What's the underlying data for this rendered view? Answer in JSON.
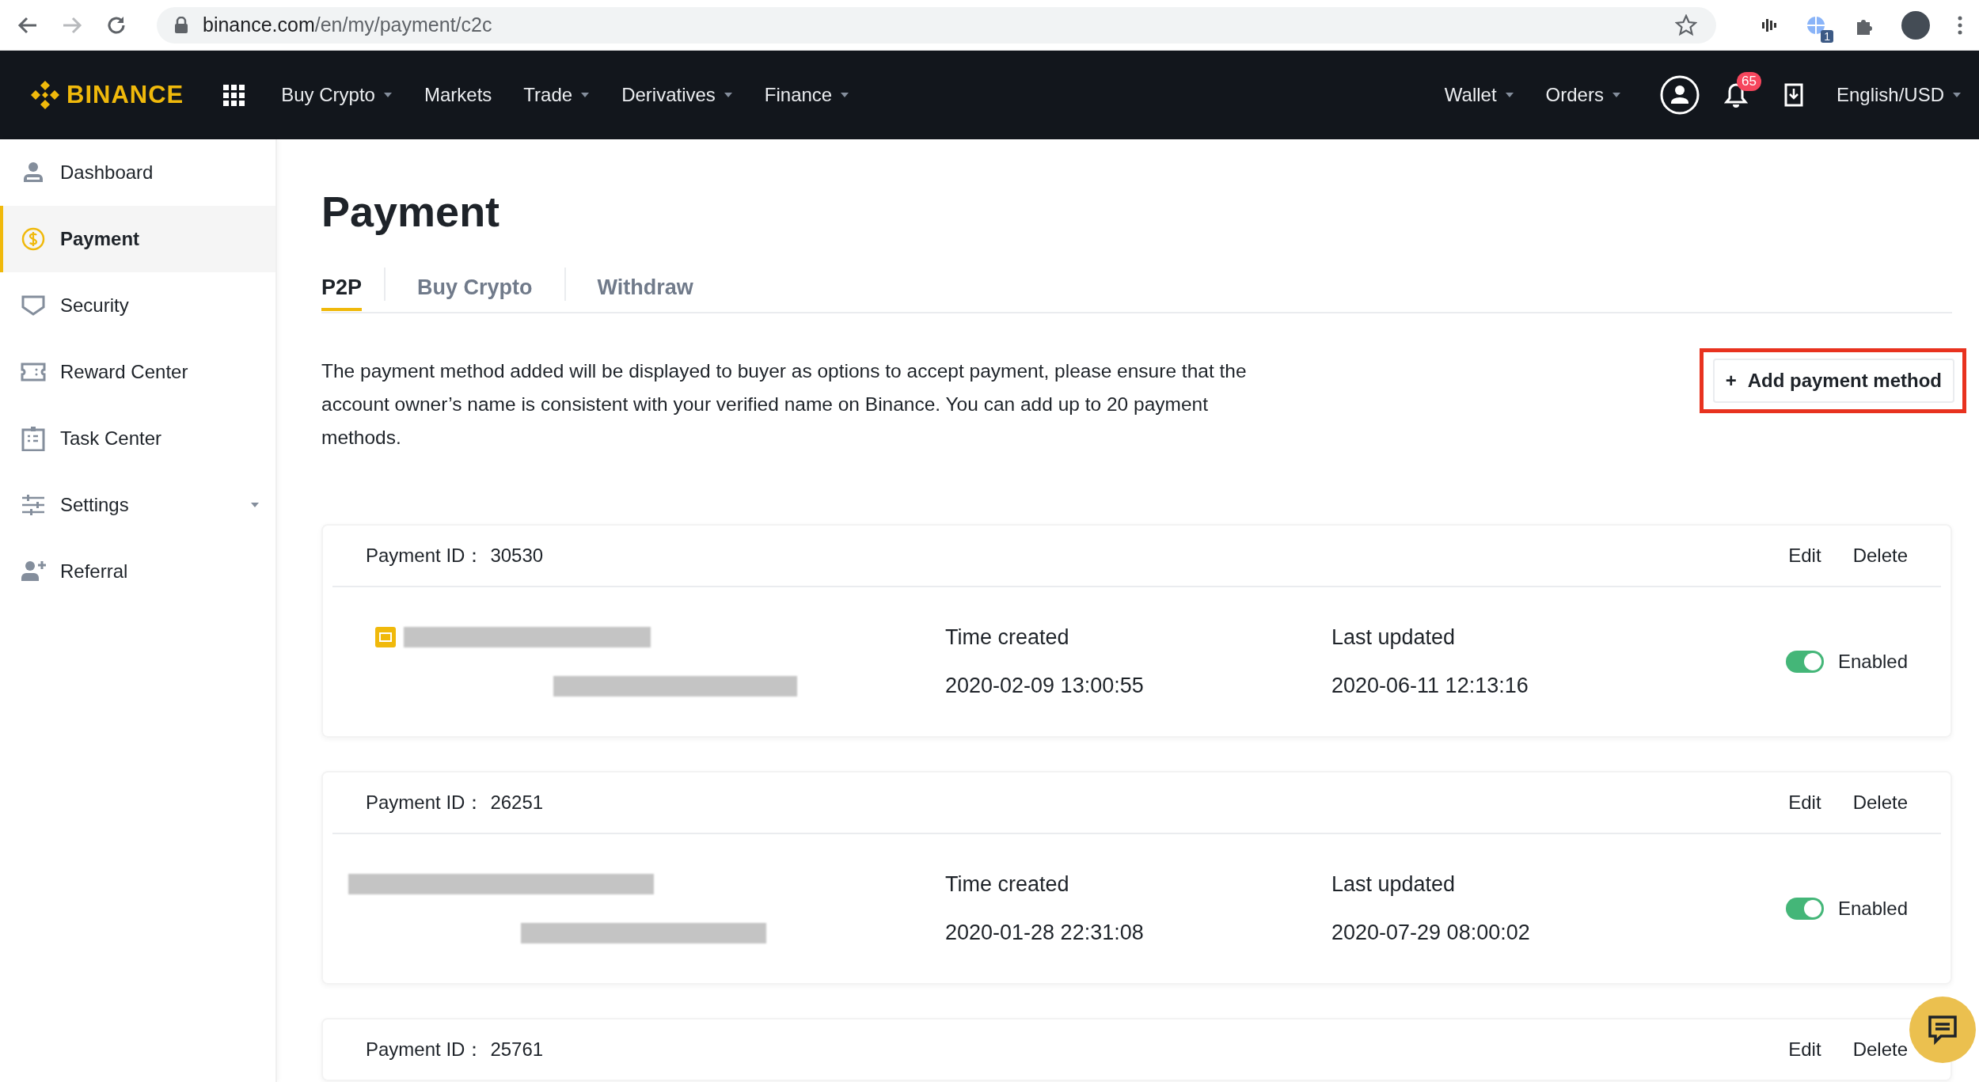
{
  "browser": {
    "url_host": "binance.com",
    "url_path": "/en/my/payment/c2c",
    "extension_badge": "1"
  },
  "nav": {
    "logo": "BINANCE",
    "items": [
      {
        "label": "Buy Crypto",
        "has_menu": true
      },
      {
        "label": "Markets",
        "has_menu": false
      },
      {
        "label": "Trade",
        "has_menu": true
      },
      {
        "label": "Derivatives",
        "has_menu": true
      },
      {
        "label": "Finance",
        "has_menu": true
      }
    ],
    "right_items": [
      {
        "label": "Wallet",
        "has_menu": true
      },
      {
        "label": "Orders",
        "has_menu": true
      }
    ],
    "notification_count": "65",
    "language": {
      "label": "English/USD",
      "has_menu": true
    }
  },
  "sidebar": {
    "items": [
      {
        "label": "Dashboard",
        "selected": false,
        "has_menu": false
      },
      {
        "label": "Payment",
        "selected": true,
        "has_menu": false
      },
      {
        "label": "Security",
        "selected": false,
        "has_menu": false
      },
      {
        "label": "Reward Center",
        "selected": false,
        "has_menu": false
      },
      {
        "label": "Task Center",
        "selected": false,
        "has_menu": false
      },
      {
        "label": "Settings",
        "selected": false,
        "has_menu": true
      },
      {
        "label": "Referral",
        "selected": false,
        "has_menu": false
      }
    ]
  },
  "page": {
    "title": "Payment",
    "tabs": [
      {
        "label": "P2P",
        "selected": true
      },
      {
        "label": "Buy Crypto",
        "selected": false
      },
      {
        "label": "Withdraw",
        "selected": false
      }
    ],
    "description": "The payment method added will be displayed to buyer as options to accept payment, please ensure that the account owner’s name is consistent with your verified name on Binance. You can add up to 20 payment methods.",
    "add_button": {
      "label": "Add payment method",
      "icon": "+",
      "highlighted": true
    }
  },
  "payments": [
    {
      "id_label": "Payment ID：",
      "id": "30530",
      "edit": "Edit",
      "delete": "Delete",
      "created_label": "Time created",
      "created": "2020-02-09 13:00:55",
      "updated_label": "Last updated",
      "updated": "2020-06-11 12:13:16",
      "enabled": true,
      "status": "Enabled"
    },
    {
      "id_label": "Payment ID：",
      "id": "26251",
      "edit": "Edit",
      "delete": "Delete",
      "created_label": "Time created",
      "created": "2020-01-28 22:31:08",
      "updated_label": "Last updated",
      "updated": "2020-07-29 08:00:02",
      "enabled": true,
      "status": "Enabled"
    },
    {
      "id_label": "Payment ID：",
      "id": "25761",
      "edit": "Edit",
      "delete": "Delete"
    }
  ]
}
